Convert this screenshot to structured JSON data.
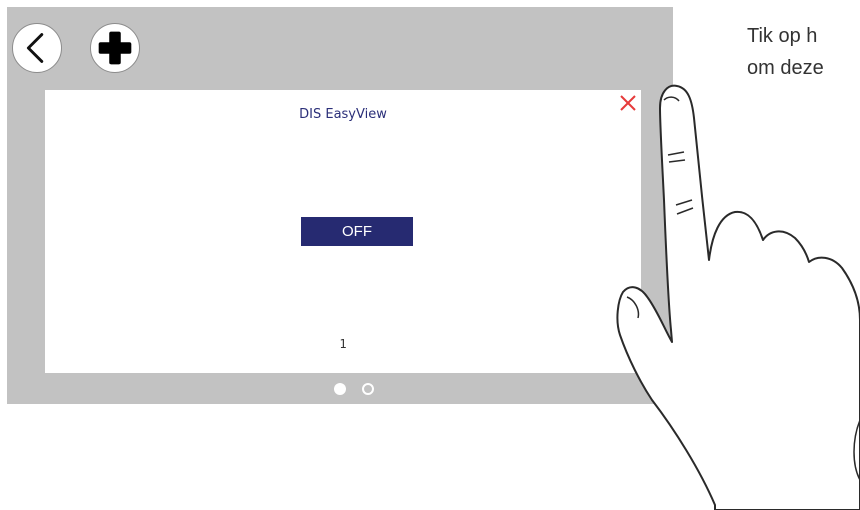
{
  "header": {
    "back_icon": "chevron-left-icon",
    "add_icon": "plus-icon"
  },
  "dialog": {
    "title": "DIS EasyView",
    "button_label": "OFF",
    "page_number": "1",
    "close_icon": "close-icon",
    "close_color": "#e63b3b"
  },
  "pager": {
    "pages": 2,
    "active": 1
  },
  "instruction": {
    "line1": "Tik op h",
    "line2": "om deze"
  },
  "colors": {
    "screen_bg": "#c2c2c2",
    "accent": "#262a71",
    "title_text": "#2b2f79"
  }
}
